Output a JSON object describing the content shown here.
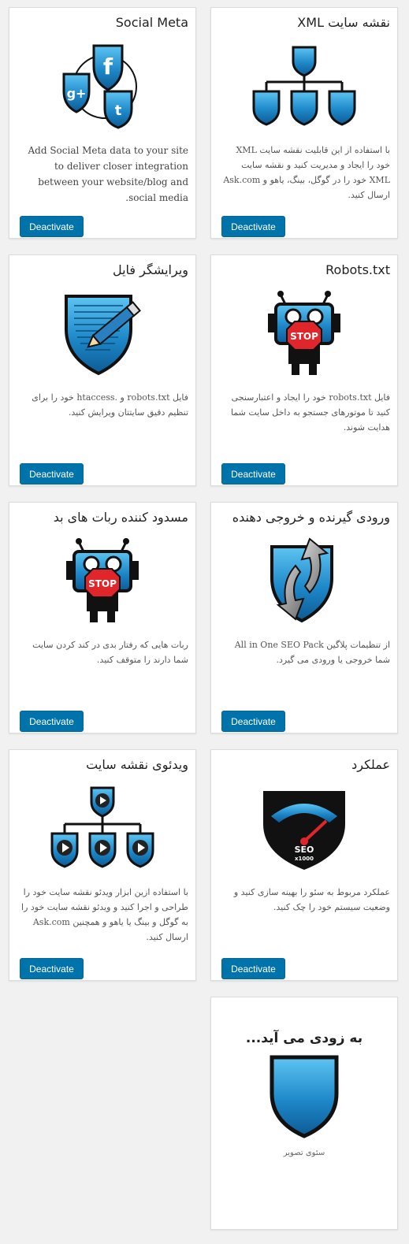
{
  "button_label": "Deactivate",
  "colors": {
    "button": "#0073aa",
    "shield": "#1e88c9",
    "shield_dark": "#0a0a0a"
  },
  "cards": {
    "social_meta": {
      "title": "Social Meta",
      "description": "Add Social Meta data to your site to deliver closer integration between your website/blog and social media.",
      "icons": [
        "facebook-icon",
        "google-plus-icon",
        "twitter-icon"
      ]
    },
    "xml_sitemap": {
      "title": "نقشه سایت XML",
      "description": "با استفاده از این قابلیت نقشه سایت XML خود را ایجاد و مدیریت کنید و نقشه سایت XML خود را در گوگل، بینگ، یاهو و Ask.com ارسال کنید.",
      "icon": "sitemap-icon"
    },
    "file_editor": {
      "title": "ویرایشگر فایل",
      "description": "فایل robots.txt و .htaccess خود را برای تنظیم دقیق سایتتان ویرایش کنید.",
      "icon": "file-editor-icon"
    },
    "robots": {
      "title": "Robots.txt",
      "description": "فایل robots.txt خود را ایجاد و اعتبارسنجی کنید تا موتورهای جستجو به داخل سایت شما هدایت شوند.",
      "icon": "robot-stop-icon",
      "stop_text": "STOP"
    },
    "bad_bot": {
      "title": "مسدود کننده ربات های بد",
      "description": "ربات هایی که رفتار بدی در کند کردن سایت شما دارند را متوقف کنید.",
      "icon": "robot-stop-icon",
      "stop_text": "STOP"
    },
    "import_export": {
      "title": "ورودی گیرنده و خروجی دهنده",
      "description": "از تنظیمات پلاگین All in One SEO Pack شما خروجی یا ورودی می گیرد.",
      "icon": "import-export-icon"
    },
    "video_sitemap": {
      "title": "ویدئوی نقشه سایت",
      "description": "با استفاده ازین ابزار ویدئو نقشه سایت خود را طراحی و اجرا کنید و ویدئو نقشه سایت خود را به گوگل و بینگ یا یاهو و همچنین Ask.com ارسال کنید.",
      "icon": "video-sitemap-icon"
    },
    "performance": {
      "title": "عملکرد",
      "description": "عملکرد مربوط به سئو را بهینه سازی کنید و وضعیت سیستم خود را چک کنید.",
      "icon": "speedometer-icon",
      "gauge_text": [
        "SEO",
        "x1000"
      ]
    }
  },
  "coming_soon": {
    "title": "به زودی می آید...",
    "label": "سئوی تصویر",
    "icon": "shield-icon"
  }
}
